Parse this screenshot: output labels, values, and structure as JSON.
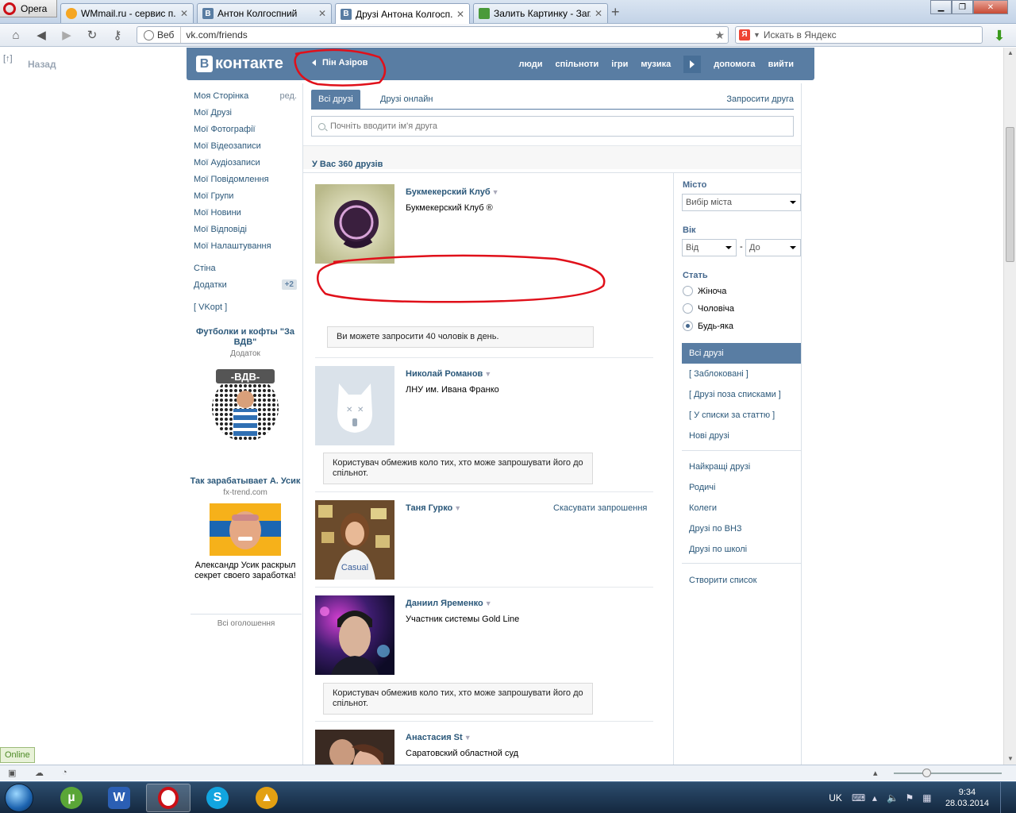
{
  "browser": {
    "menu_label": "Opera",
    "tabs": [
      {
        "title": "WMmail.ru - сервис п...",
        "icon": "wmmail-icon",
        "color": "#f5a623"
      },
      {
        "title": "Антон Колгоспний",
        "icon": "vk-icon",
        "color": "#597da3"
      },
      {
        "title": "Друзі Антона Колгосп...",
        "icon": "vk-icon",
        "color": "#597da3",
        "active": true
      },
      {
        "title": "Залить Картинку - Заг...",
        "icon": "image-icon",
        "color": "#4a9a3a"
      }
    ],
    "address_mode": "Веб",
    "url": "vk.com/friends",
    "search_placeholder": "Искать в Яндекс"
  },
  "page": {
    "back_top": "[↑]",
    "back_label": "Назад",
    "header": {
      "logo_letter": "В",
      "logo_text": "контакте",
      "pinned_user": "Пін Азіров",
      "nav": [
        "люди",
        "спільноти",
        "ігри",
        "музика",
        "допомога",
        "вийти"
      ]
    },
    "left_menu": {
      "items": [
        {
          "label": "Моя Сторінка",
          "extra": "ред."
        },
        {
          "label": "Мої Друзі"
        },
        {
          "label": "Мої Фотографії"
        },
        {
          "label": "Мої Відеозаписи"
        },
        {
          "label": "Мої Аудіозаписи"
        },
        {
          "label": "Мої Повідомлення"
        },
        {
          "label": "Мої Групи"
        },
        {
          "label": "Мої Новини"
        },
        {
          "label": "Мої Відповіді"
        },
        {
          "label": "Мої Налаштування"
        }
      ],
      "items2": [
        {
          "label": "Стіна"
        },
        {
          "label": "Додатки",
          "badge": "+2"
        }
      ],
      "vkopt": "[ VKopt ]"
    },
    "ads": [
      {
        "title": "Футболки и кофты \"За ВДВ\"",
        "sub": "Додаток",
        "pic_label": "-ВДВ-"
      },
      {
        "title": "Так зарабатывает А. Усик",
        "sub": "fx-trend.com",
        "desc": "Александр Усик раскрыл секрет своего заработка!"
      }
    ],
    "all_ads": "Всі оголошення",
    "friends": {
      "tabs": [
        "Всі друзі",
        "Друзі онлайн"
      ],
      "invite": "Запросити друга",
      "search_placeholder": "Почніть вводити ім'я друга",
      "count": "У Вас 360 друзів",
      "list": [
        {
          "name": "Букмекерский Клуб",
          "sub": "Букмекерский Клуб ®",
          "notice": "Ви можете запросити 40 чоловік в день."
        },
        {
          "name": "Николай Романов",
          "sub": "ЛНУ им. Ивана Франко",
          "notice": "Користувач обмежив коло тих, хто може запрошувати його до спільнот."
        },
        {
          "name": "Таня Гурко",
          "sub": "",
          "action": "Скасувати запрошення"
        },
        {
          "name": "Даниил Яременко",
          "sub": "Участник системы Gold Line",
          "notice": "Користувач обмежив коло тих, хто може запрошувати його до спільнот."
        },
        {
          "name": "Анастасия St",
          "sub": "Саратовский областной суд"
        }
      ]
    },
    "filters": {
      "city_label": "Місто",
      "city_value": "Вибір міста",
      "age_label": "Вік",
      "age_from": "Від",
      "age_dash": "-",
      "age_to": "До",
      "sex_label": "Стать",
      "sex_options": [
        "Жіноча",
        "Чоловіча",
        "Будь-яка"
      ],
      "sex_selected": 2,
      "lists_a": [
        "Всі друзі",
        "[ Заблоковані ]",
        "[ Друзі поза списками ]",
        "[ У списки за статтю ]",
        "Нові друзі"
      ],
      "lists_b": [
        "Найкращі друзі",
        "Родичі",
        "Колеги",
        "Друзі по ВНЗ",
        "Друзі по школі"
      ],
      "create": "Створити список"
    }
  },
  "status": {
    "online": "Online"
  },
  "taskbar": {
    "lang": "UK",
    "time": "9:34",
    "date": "28.03.2014"
  },
  "colors": {
    "vk_blue": "#597da3",
    "link": "#2b587a",
    "annotation": "#e0101a"
  }
}
